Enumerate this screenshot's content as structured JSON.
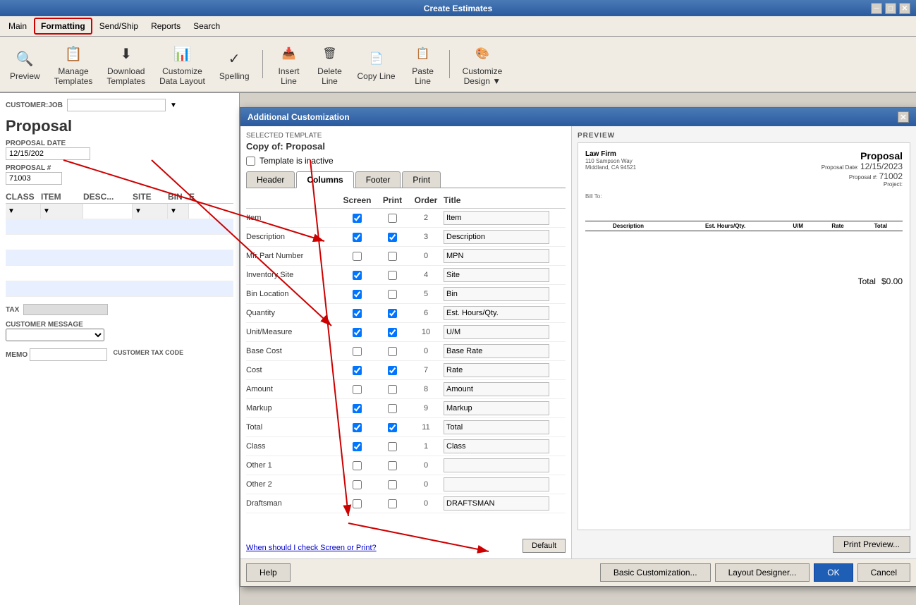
{
  "window": {
    "title": "Create Estimates"
  },
  "menubar": {
    "items": [
      "Main",
      "Formatting",
      "Send/Ship",
      "Reports",
      "Search"
    ],
    "active": "Formatting"
  },
  "toolbar": {
    "buttons": [
      {
        "label": "Preview",
        "icon": "🔍"
      },
      {
        "label": "Manage\nTemplates",
        "icon": "📋"
      },
      {
        "label": "Download\nTemplates",
        "icon": "⬇"
      },
      {
        "label": "Customize\nData Layout",
        "icon": "📊"
      },
      {
        "label": "Spelling",
        "icon": "✓"
      },
      {
        "label": "Insert\nLine",
        "icon": "➕"
      },
      {
        "label": "Delete\nLine",
        "icon": "➖"
      },
      {
        "label": "Copy Line",
        "icon": "📄"
      },
      {
        "label": "Paste\nLine",
        "icon": "📋"
      },
      {
        "label": "Customize\nDesign ▼",
        "icon": "🎨"
      }
    ]
  },
  "estimate": {
    "customer_job_label": "CUSTOMER:JOB",
    "title": "Proposal",
    "proposal_date_label": "PROPOSAL DATE",
    "proposal_date": "12/15/202",
    "proposal_num_label": "PROPOSAL #",
    "proposal_num": "71003",
    "columns": [
      "CLASS",
      "ITEM",
      "DESC...",
      "SITE",
      "BIN",
      "E"
    ],
    "tax_label": "TAX",
    "customer_message_label": "CUSTOMER MESSAGE",
    "memo_label": "MEMO",
    "customer_tax_code_label": "CUSTOMER TAX CODE"
  },
  "dialog": {
    "title": "Additional Customization",
    "selected_template_label": "SELECTED TEMPLATE",
    "template_name": "Copy of: Proposal",
    "template_inactive_label": "Template is inactive",
    "tabs": [
      "Header",
      "Columns",
      "Footer",
      "Print"
    ],
    "active_tab": "Columns",
    "columns_header": {
      "col1": "",
      "screen": "Screen",
      "print": "Print",
      "order": "Order",
      "title": "Title"
    },
    "rows": [
      {
        "label": "Item",
        "screen": true,
        "print": false,
        "order": "2",
        "title": "Item"
      },
      {
        "label": "Description",
        "screen": true,
        "print": true,
        "order": "3",
        "title": "Description"
      },
      {
        "label": "Mfr Part Number",
        "screen": false,
        "print": false,
        "order": "0",
        "title": "MPN"
      },
      {
        "label": "Inventory Site",
        "screen": true,
        "print": false,
        "order": "4",
        "title": "Site"
      },
      {
        "label": "Bin Location",
        "screen": true,
        "print": false,
        "order": "5",
        "title": "Bin"
      },
      {
        "label": "Quantity",
        "screen": true,
        "print": true,
        "order": "6",
        "title": "Est. Hours/Qty."
      },
      {
        "label": "Unit/Measure",
        "screen": true,
        "print": true,
        "order": "10",
        "title": "U/M"
      },
      {
        "label": "Base Cost",
        "screen": false,
        "print": false,
        "order": "0",
        "title": "Base Rate"
      },
      {
        "label": "Cost",
        "screen": true,
        "print": true,
        "order": "7",
        "title": "Rate"
      },
      {
        "label": "Amount",
        "screen": false,
        "print": false,
        "order": "8",
        "title": "Amount"
      },
      {
        "label": "Markup",
        "screen": true,
        "print": false,
        "order": "9",
        "title": "Markup"
      },
      {
        "label": "Total",
        "screen": true,
        "print": true,
        "order": "11",
        "title": "Total"
      },
      {
        "label": "Class",
        "screen": true,
        "print": false,
        "order": "1",
        "title": "Class"
      },
      {
        "label": "Other 1",
        "screen": false,
        "print": false,
        "order": "0",
        "title": ""
      },
      {
        "label": "Other 2",
        "screen": false,
        "print": false,
        "order": "0",
        "title": ""
      },
      {
        "label": "Draftsman",
        "screen": false,
        "print": false,
        "order": "0",
        "title": "DRAFTSMAN"
      }
    ],
    "bottom_link": "When should I check Screen or Print?",
    "default_btn": "Default",
    "preview_label": "PREVIEW",
    "preview": {
      "firm": "Law Firm",
      "address": "110 Sampson Way\nMiddland, CA 94521",
      "doc_title": "Proposal",
      "proposal_date": "12/15/2023",
      "proposal_num": "71002",
      "project": "",
      "bill_to": "Bill To:",
      "table_headers": [
        "Description",
        "Est. Hours/Qty.",
        "U/M",
        "Rate",
        "Total"
      ],
      "total_label": "Total",
      "total_value": "$0.00"
    },
    "print_preview_btn": "Print Preview...",
    "footer": {
      "help": "Help",
      "basic_customization": "Basic Customization...",
      "layout_designer": "Layout Designer...",
      "ok": "OK",
      "cancel": "Cancel"
    }
  }
}
